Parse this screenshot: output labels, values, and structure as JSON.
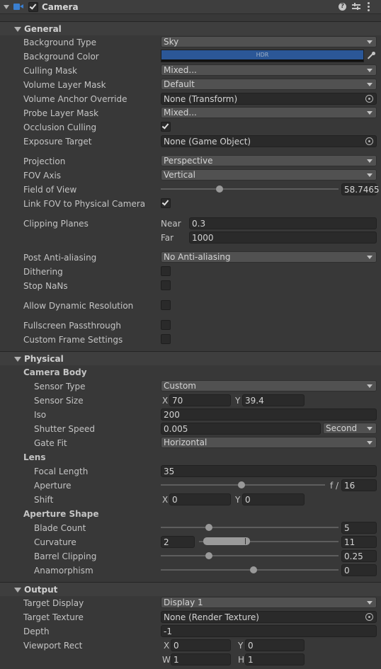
{
  "header": {
    "title": "Camera",
    "enabled": true,
    "icons": [
      "camera-icon",
      "help-icon",
      "presets-icon",
      "more-icon"
    ]
  },
  "general": {
    "title": "General",
    "background_type": {
      "label": "Background Type",
      "value": "Sky"
    },
    "background_color": {
      "label": "Background Color",
      "hdr_text": "HDR",
      "color": "#2b5797"
    },
    "culling_mask": {
      "label": "Culling Mask",
      "value": "Mixed..."
    },
    "volume_layer_mask": {
      "label": "Volume Layer Mask",
      "value": "Default"
    },
    "volume_anchor_override": {
      "label": "Volume Anchor Override",
      "value": "None (Transform)"
    },
    "probe_layer_mask": {
      "label": "Probe Layer Mask",
      "value": "Mixed..."
    },
    "occlusion_culling": {
      "label": "Occlusion Culling",
      "checked": true
    },
    "exposure_target": {
      "label": "Exposure Target",
      "value": "None (Game Object)"
    },
    "projection": {
      "label": "Projection",
      "value": "Perspective"
    },
    "fov_axis": {
      "label": "FOV Axis",
      "value": "Vertical"
    },
    "field_of_view": {
      "label": "Field of View",
      "value": "58.7465",
      "slider_fraction": 0.33
    },
    "link_fov": {
      "label": "Link FOV to Physical Camera",
      "checked": true
    },
    "clipping_planes": {
      "label": "Clipping Planes",
      "near_label": "Near",
      "near": "0.3",
      "far_label": "Far",
      "far": "1000"
    },
    "post_aa": {
      "label": "Post Anti-aliasing",
      "value": "No Anti-aliasing"
    },
    "dithering": {
      "label": "Dithering",
      "checked": false
    },
    "stop_nans": {
      "label": "Stop NaNs",
      "checked": false
    },
    "allow_dynamic_resolution": {
      "label": "Allow Dynamic Resolution",
      "checked": false
    },
    "fullscreen_passthrough": {
      "label": "Fullscreen Passthrough",
      "checked": false
    },
    "custom_frame_settings": {
      "label": "Custom Frame Settings",
      "checked": false
    }
  },
  "physical": {
    "title": "Physical",
    "camera_body": "Camera Body",
    "sensor_type": {
      "label": "Sensor Type",
      "value": "Custom"
    },
    "sensor_size": {
      "label": "Sensor Size",
      "x_label": "X",
      "x": "70",
      "y_label": "Y",
      "y": "39.4"
    },
    "iso": {
      "label": "Iso",
      "value": "200"
    },
    "shutter_speed": {
      "label": "Shutter Speed",
      "value": "0.005",
      "unit": "Second"
    },
    "gate_fit": {
      "label": "Gate Fit",
      "value": "Horizontal"
    },
    "lens": "Lens",
    "focal_length": {
      "label": "Focal Length",
      "value": "35"
    },
    "aperture": {
      "label": "Aperture",
      "prefix": "f /",
      "value": "16",
      "slider_fraction": 0.49
    },
    "shift": {
      "label": "Shift",
      "x_label": "X",
      "x": "0",
      "y_label": "Y",
      "y": "0"
    },
    "aperture_shape": "Aperture Shape",
    "blade_count": {
      "label": "Blade Count",
      "value": "5",
      "slider_fraction": 0.27
    },
    "curvature": {
      "label": "Curvature",
      "min": "2",
      "max": "11"
    },
    "barrel_clipping": {
      "label": "Barrel Clipping",
      "value": "0.25",
      "slider_fraction": 0.27
    },
    "anamorphism": {
      "label": "Anamorphism",
      "value": "0",
      "slider_fraction": 0.52
    }
  },
  "output": {
    "title": "Output",
    "target_display": {
      "label": "Target Display",
      "value": "Display 1"
    },
    "target_texture": {
      "label": "Target Texture",
      "value": "None (Render Texture)"
    },
    "depth": {
      "label": "Depth",
      "value": "-1"
    },
    "viewport_rect": {
      "label": "Viewport Rect",
      "x_label": "X",
      "x": "0",
      "y_label": "Y",
      "y": "0",
      "w_label": "W",
      "w": "1",
      "h_label": "H",
      "h": "1"
    }
  }
}
